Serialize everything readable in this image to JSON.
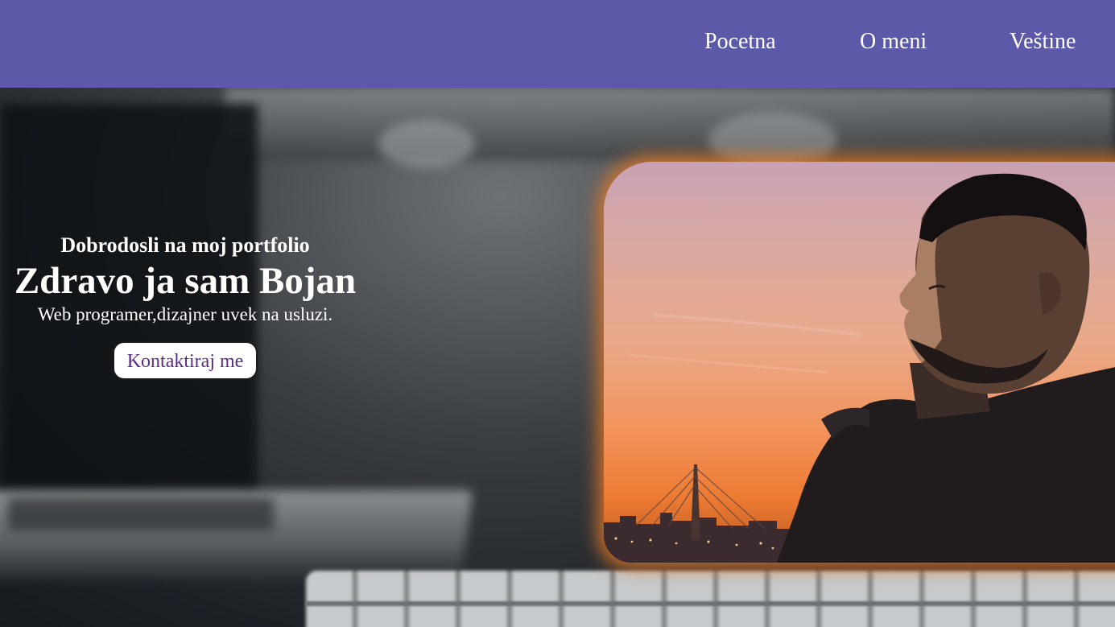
{
  "nav": {
    "links": [
      "Pocetna",
      "O meni",
      "Veštine"
    ]
  },
  "hero": {
    "greeting": "Dobrodosli na moj portfolio",
    "headline": "Zdravo ja sam Bojan",
    "tagline": "Web programer,dizajner uvek na usluzi.",
    "cta_label": "Kontaktiraj me"
  },
  "colors": {
    "nav_background": "#5c5aa8",
    "cta_text": "#5b2c86",
    "photo_glow": "#e07828"
  }
}
